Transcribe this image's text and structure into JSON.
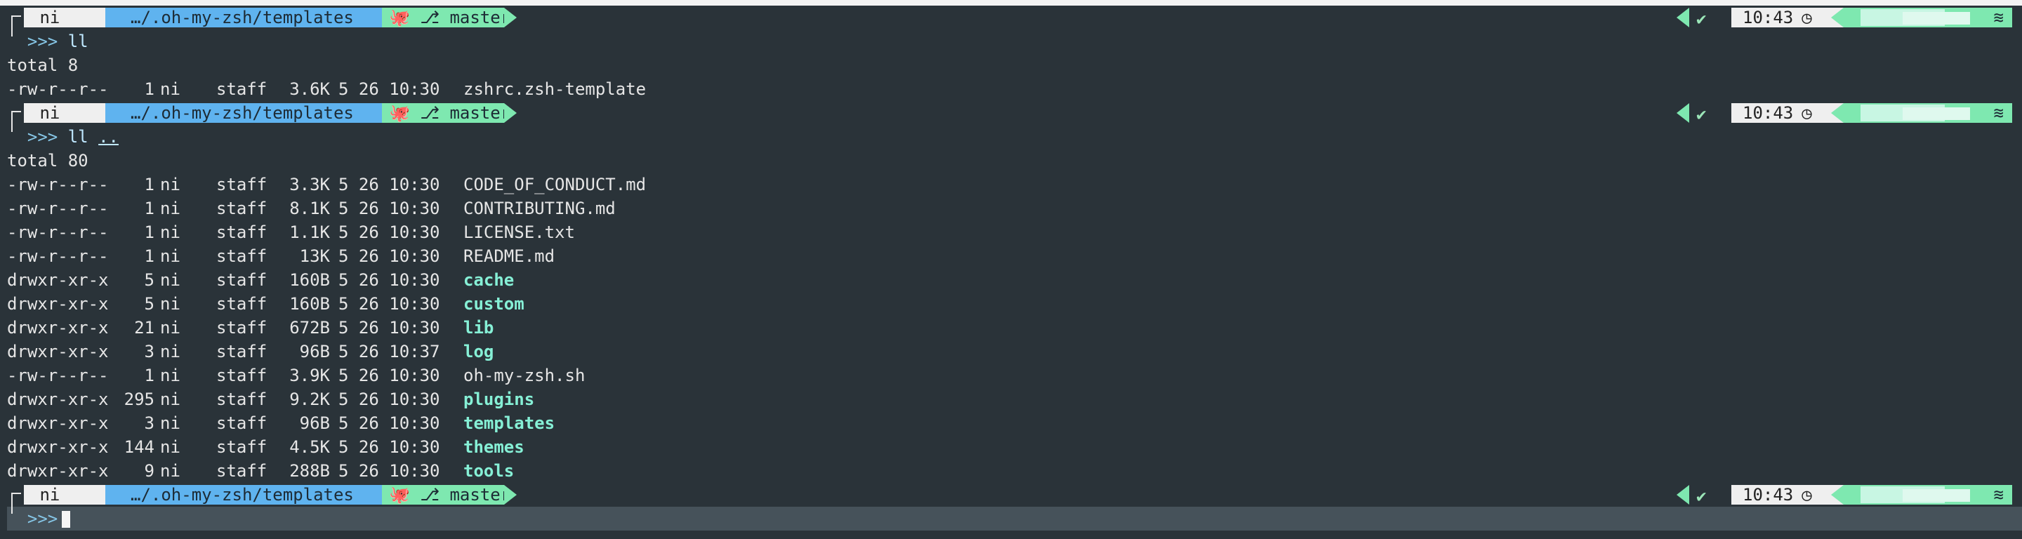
{
  "prompt": {
    "dir_label": "…/.oh-my-zsh/templates",
    "branch_label": "master",
    "time": "10:43",
    "user_segment": "ni",
    "prompt_symbol": ">>>"
  },
  "blocks": [
    {
      "command": "ll",
      "arg": "",
      "output": [
        {
          "type": "text",
          "value": "total 8"
        },
        {
          "type": "entry",
          "perm": "-rw-r--r--",
          "links": "1",
          "user": "ni",
          "group": "staff",
          "size": "3.6K",
          "date": "5 26 10:30",
          "name": "zshrc.zsh-template",
          "is_dir": false
        }
      ]
    },
    {
      "command": "ll",
      "arg": "..",
      "output": [
        {
          "type": "text",
          "value": "total 80"
        },
        {
          "type": "entry",
          "perm": "-rw-r--r--",
          "links": "1",
          "user": "ni",
          "group": "staff",
          "size": "3.3K",
          "date": "5 26 10:30",
          "name": "CODE_OF_CONDUCT.md",
          "is_dir": false
        },
        {
          "type": "entry",
          "perm": "-rw-r--r--",
          "links": "1",
          "user": "ni",
          "group": "staff",
          "size": "8.1K",
          "date": "5 26 10:30",
          "name": "CONTRIBUTING.md",
          "is_dir": false
        },
        {
          "type": "entry",
          "perm": "-rw-r--r--",
          "links": "1",
          "user": "ni",
          "group": "staff",
          "size": "1.1K",
          "date": "5 26 10:30",
          "name": "LICENSE.txt",
          "is_dir": false
        },
        {
          "type": "entry",
          "perm": "-rw-r--r--",
          "links": "1",
          "user": "ni",
          "group": "staff",
          "size": "13K",
          "date": "5 26 10:30",
          "name": "README.md",
          "is_dir": false
        },
        {
          "type": "entry",
          "perm": "drwxr-xr-x",
          "links": "5",
          "user": "ni",
          "group": "staff",
          "size": "160B",
          "date": "5 26 10:30",
          "name": "cache",
          "is_dir": true
        },
        {
          "type": "entry",
          "perm": "drwxr-xr-x",
          "links": "5",
          "user": "ni",
          "group": "staff",
          "size": "160B",
          "date": "5 26 10:30",
          "name": "custom",
          "is_dir": true
        },
        {
          "type": "entry",
          "perm": "drwxr-xr-x",
          "links": "21",
          "user": "ni",
          "group": "staff",
          "size": "672B",
          "date": "5 26 10:30",
          "name": "lib",
          "is_dir": true
        },
        {
          "type": "entry",
          "perm": "drwxr-xr-x",
          "links": "3",
          "user": "ni",
          "group": "staff",
          "size": "96B",
          "date": "5 26 10:37",
          "name": "log",
          "is_dir": true
        },
        {
          "type": "entry",
          "perm": "-rw-r--r--",
          "links": "1",
          "user": "ni",
          "group": "staff",
          "size": "3.9K",
          "date": "5 26 10:30",
          "name": "oh-my-zsh.sh",
          "is_dir": false
        },
        {
          "type": "entry",
          "perm": "drwxr-xr-x",
          "links": "295",
          "user": "ni",
          "group": "staff",
          "size": "9.2K",
          "date": "5 26 10:30",
          "name": "plugins",
          "is_dir": true
        },
        {
          "type": "entry",
          "perm": "drwxr-xr-x",
          "links": "3",
          "user": "ni",
          "group": "staff",
          "size": "96B",
          "date": "5 26 10:30",
          "name": "templates",
          "is_dir": true
        },
        {
          "type": "entry",
          "perm": "drwxr-xr-x",
          "links": "144",
          "user": "ni",
          "group": "staff",
          "size": "4.5K",
          "date": "5 26 10:30",
          "name": "themes",
          "is_dir": true
        },
        {
          "type": "entry",
          "perm": "drwxr-xr-x",
          "links": "9",
          "user": "ni",
          "group": "staff",
          "size": "288B",
          "date": "5 26 10:30",
          "name": "tools",
          "is_dir": true
        }
      ]
    }
  ],
  "colors": {
    "background": "#2a3339",
    "dir_segment": "#5fb3ef",
    "git_segment": "#7ee8b0",
    "light_segment": "#efefef",
    "directory_text": "#86f0d6"
  },
  "icons": [
    "apple-icon",
    "folder-icon",
    "github-icon",
    "git-branch-icon",
    "check-icon",
    "clock-icon",
    "wifi-icon"
  ]
}
